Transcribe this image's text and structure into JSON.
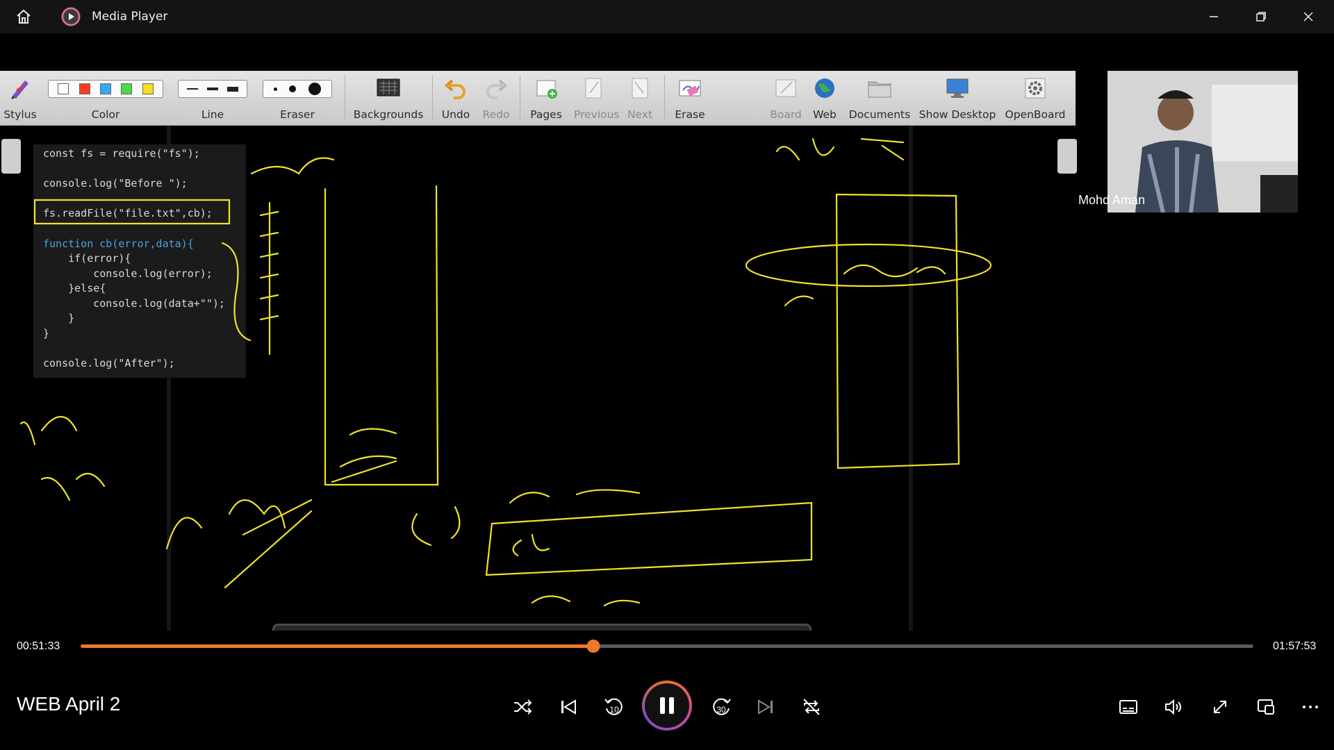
{
  "window": {
    "title": "Media Player"
  },
  "toolbar": {
    "stylus": "Stylus",
    "color": "Color",
    "line": "Line",
    "eraser": "Eraser",
    "backgrounds": "Backgrounds",
    "undo": "Undo",
    "redo": "Redo",
    "pages": "Pages",
    "previous": "Previous",
    "next": "Next",
    "erase": "Erase",
    "board": "Board",
    "web": "Web",
    "documents": "Documents",
    "show_desktop": "Show Desktop",
    "openboard": "OpenBoard",
    "swatches": [
      "#ffffff",
      "#ff3b1f",
      "#35a8f0",
      "#50d64a",
      "#f5e11a"
    ]
  },
  "code": {
    "lines": [
      "const fs = require(\"fs\");",
      "console.log(\"Before \");",
      "fs.readFile(\"file.txt\",cb);",
      "function cb(error,data){",
      "    if(error){",
      "        console.log(error);",
      "    }else{",
      "        console.log(data+\"\");",
      "    }",
      "}",
      "console.log(\"After\");"
    ]
  },
  "webcam": {
    "presenter_name": "Mohd Aman"
  },
  "player": {
    "elapsed": "00:51:33",
    "total": "01:57:53",
    "progress": 0.4374,
    "media_title": "WEB April 2",
    "skip_back_seconds": "10",
    "skip_forward_seconds": "30",
    "accent_color": "#f0782a"
  }
}
